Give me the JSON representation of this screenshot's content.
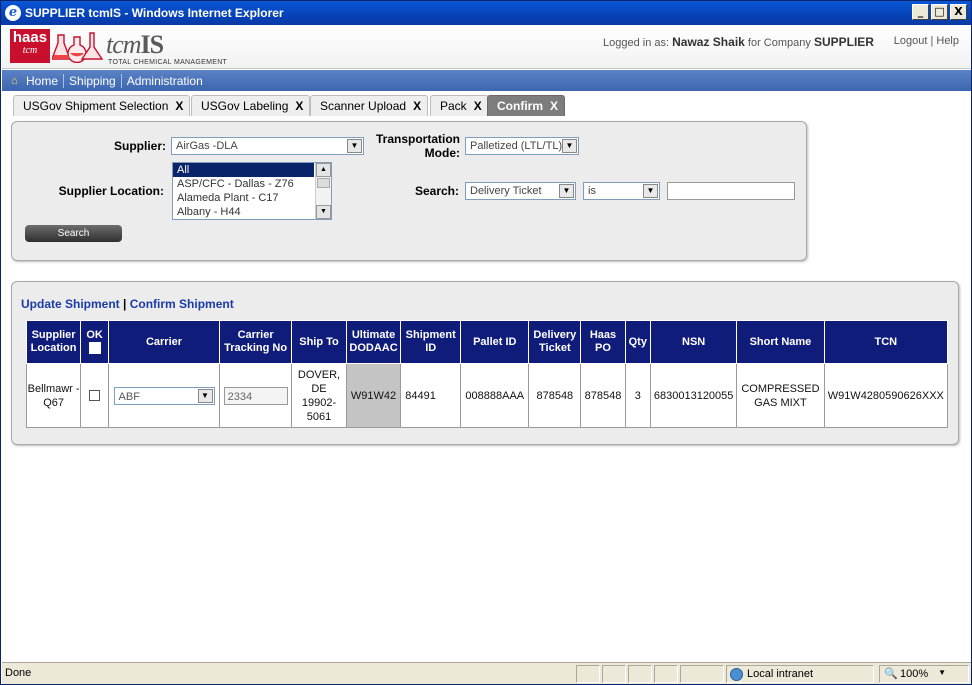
{
  "window": {
    "title": "SUPPLIER tcmIS - Windows Internet Explorer",
    "controls": [
      "_",
      "□",
      "X"
    ]
  },
  "header": {
    "logo_haas": "haas",
    "logo_tcm_small": "tcm",
    "logo_brand_italic": "tcm",
    "logo_brand_bold": "IS",
    "logo_tagline": "TOTAL CHEMICAL MANAGEMENT",
    "logged_prefix": "Logged in as:",
    "user_name": "Nawaz Shaik",
    "company_prefix": "for Company",
    "company": "SUPPLIER",
    "logout": "Logout",
    "help": "Help"
  },
  "nav": {
    "items": [
      "Home",
      "Shipping",
      "Administration"
    ]
  },
  "tabs": [
    {
      "label": "USGov Shipment Selection",
      "close": "X"
    },
    {
      "label": "USGov Labeling",
      "close": "X"
    },
    {
      "label": "Scanner Upload",
      "close": "X"
    },
    {
      "label": "Pack",
      "close": "X"
    },
    {
      "label": "Confirm",
      "close": "X"
    }
  ],
  "search": {
    "supplier_label": "Supplier:",
    "supplier_value": "AirGas -DLA",
    "transport_label_1": "Transportation",
    "transport_label_2": "Mode:",
    "transport_value": "Palletized (LTL/TL)",
    "location_label": "Supplier Location:",
    "locations": [
      "All",
      "ASP/CFC - Dallas - Z76",
      "Alameda Plant - C17",
      "Albany - H44"
    ],
    "search_label": "Search:",
    "search_field": "Delivery Ticket",
    "search_op": "is",
    "search_text": "",
    "button": "Search"
  },
  "results": {
    "update_link": "Update Shipment",
    "separator": "|",
    "confirm_link": "Confirm Shipment",
    "columns": [
      "Supplier Location",
      "OK",
      "Carrier",
      "Carrier Tracking No",
      "Ship To",
      "Ultimate DODAAC",
      "Shipment ID",
      "Pallet ID",
      "Delivery Ticket",
      "Haas PO",
      "Qty",
      "NSN",
      "Short Name",
      "TCN"
    ],
    "rows": [
      {
        "supplier_location": "Bellmawr - Q67",
        "carrier": "ABF",
        "tracking_no": "2334",
        "ship_to": "DOVER, DE 19902-5061",
        "dodaac": "W91W42",
        "shipment_id": "84491",
        "pallet_id": "008888AAA",
        "delivery_ticket": "878548",
        "haas_po": "878548",
        "qty": "3",
        "nsn": "6830013120055",
        "short_name": "COMPRESSED GAS MIXT",
        "tcn": "W91W4280590626XXX"
      }
    ]
  },
  "status": {
    "left": "Done",
    "zone": "Local intranet",
    "zoom": "100%"
  },
  "colors": {
    "title_bar": "#0a57d6",
    "nav_bar": "#4a72ba",
    "table_header": "#101c7a",
    "link": "#1a3ba8"
  }
}
